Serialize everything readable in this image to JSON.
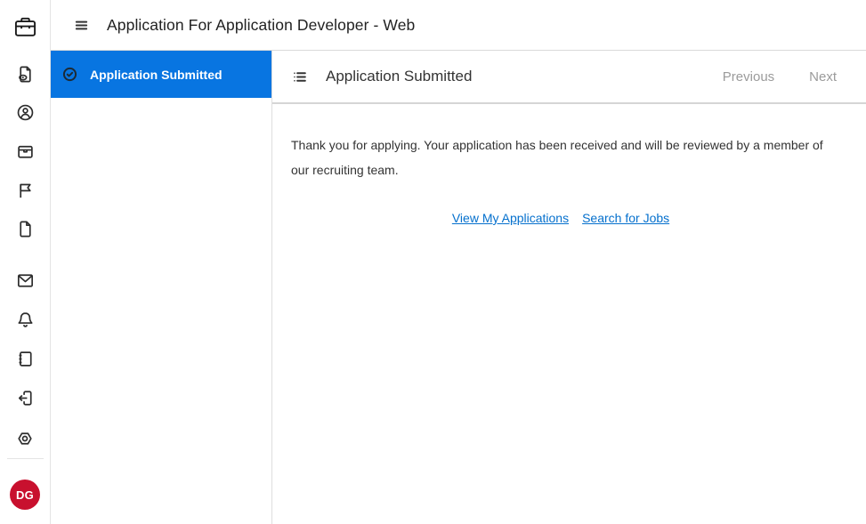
{
  "colors": {
    "accent_blue": "#0875e1",
    "link_blue": "#0570cd",
    "avatar_red": "#c8102e",
    "disabled_gray": "#9b9b9b",
    "icon_dark": "#2d2d2d",
    "check_on_blue": "#1d2b36"
  },
  "topbar": {
    "menu_icon": "hamburger-icon",
    "title": "Application For Application Developer - Web"
  },
  "rail": {
    "logo_icon": "briefcase-icon",
    "icons": [
      "document-preview-icon",
      "user-profile-icon",
      "archive-icon",
      "flag-icon",
      "document-icon",
      "mail-icon",
      "notifications-icon",
      "notebook-icon",
      "sign-out-icon",
      "settings-icon"
    ],
    "avatar_initials": "DG"
  },
  "sidebar": {
    "items": [
      {
        "label": "Application Submitted",
        "icon": "check-circle-icon",
        "active": true
      }
    ]
  },
  "main": {
    "header": {
      "icon": "list-icon",
      "title": "Application Submitted",
      "previous_label": "Previous",
      "next_label": "Next"
    },
    "body": {
      "message": "Thank you for applying. Your application has been received and will be reviewed by a member of our recruiting team.",
      "links": [
        {
          "label": "View My Applications"
        },
        {
          "label": "Search for Jobs"
        }
      ]
    }
  }
}
